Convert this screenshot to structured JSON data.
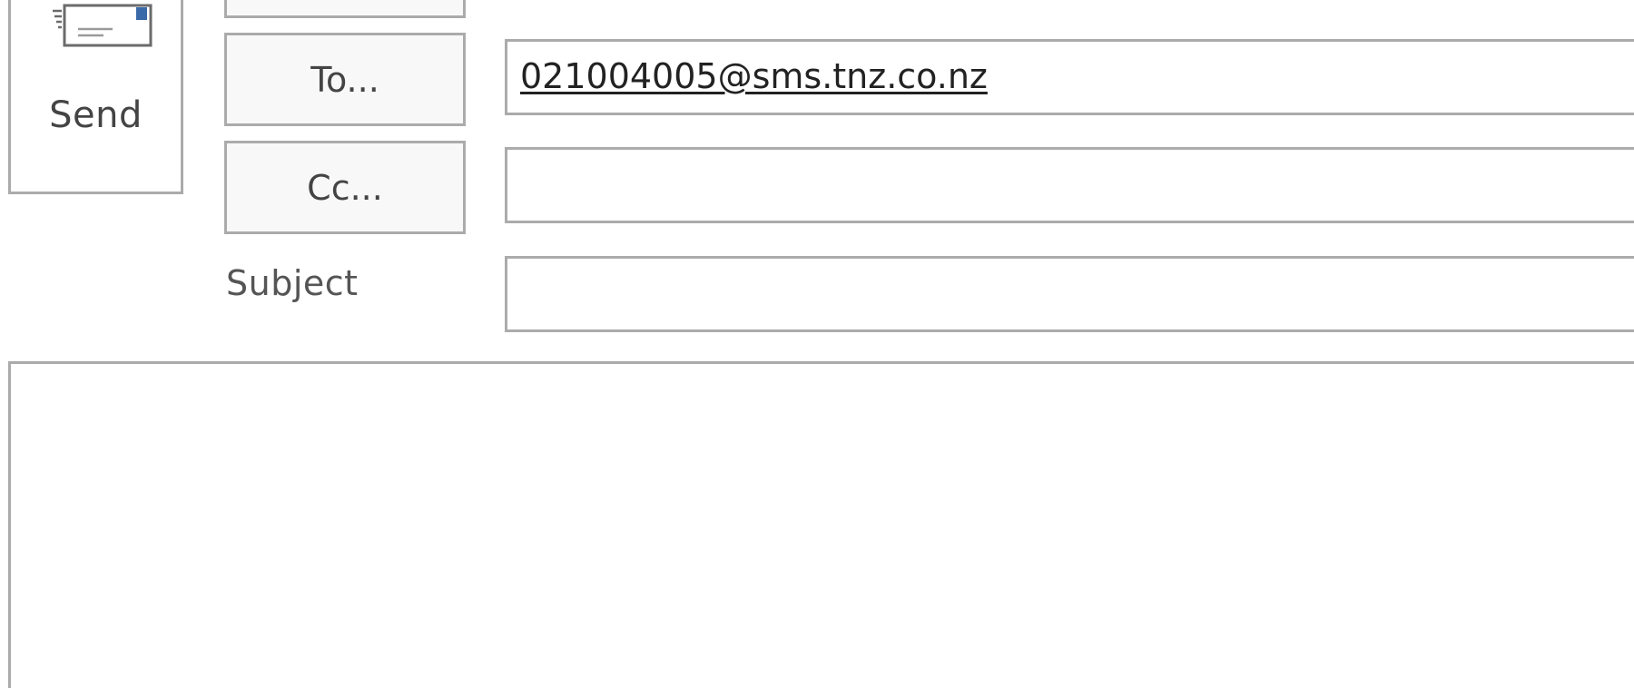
{
  "toolbar": {
    "send_label": "Send",
    "send_icon": "envelope-send-icon"
  },
  "address": {
    "to_button_label": "To...",
    "cc_button_label": "Cc...",
    "subject_label": "Subject",
    "to_value": "021004005@sms.tnz.co.nz",
    "cc_value": "",
    "subject_value": ""
  },
  "message": {
    "body": ""
  },
  "colors": {
    "border": "#ababab",
    "button_bg": "#f8f8f8",
    "text": "#444444",
    "icon_accent": "#3a6aa8"
  }
}
